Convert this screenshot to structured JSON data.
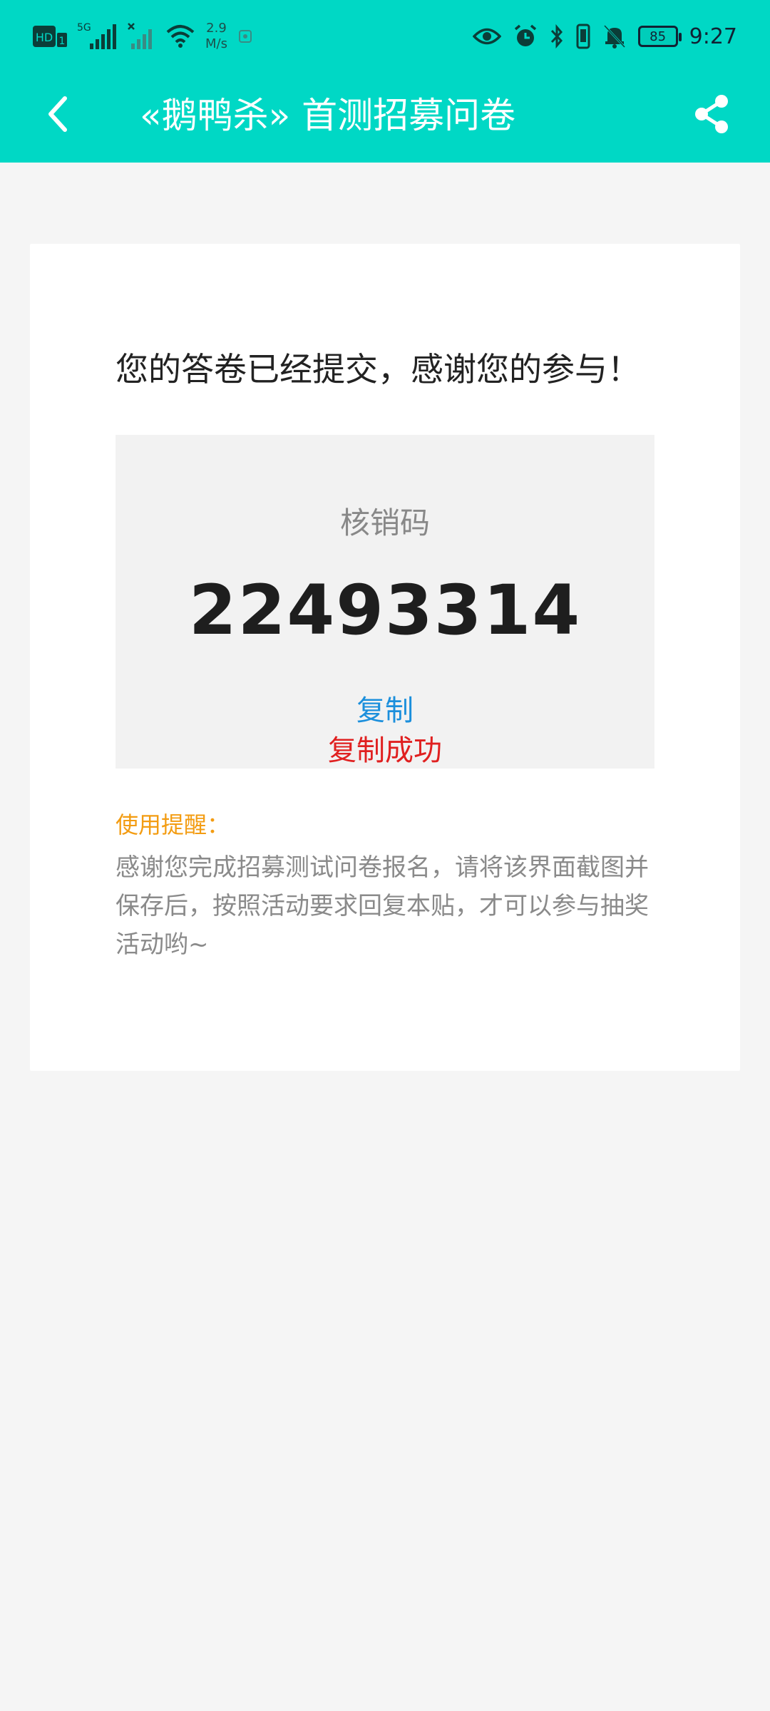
{
  "status_bar": {
    "network_badge": "HD",
    "sim_indicator": "1",
    "network_type": "5G",
    "speed_value": "2.9",
    "speed_unit": "M/s",
    "battery": "85",
    "time": "9:27",
    "icons": [
      "hd-icon",
      "signal-icon",
      "wifi-icon",
      "eye-icon",
      "alarm-icon",
      "bluetooth-icon",
      "vibrate-icon",
      "mute-icon",
      "battery-icon"
    ]
  },
  "app_bar": {
    "title": "«鹅鸭杀» 首测招募问卷",
    "back_icon": "chevron-left-icon",
    "share_icon": "share-icon"
  },
  "result": {
    "headline": "您的答卷已经提交，感谢您的参与！",
    "code_label": "核销码",
    "code_value": "22493314",
    "copy_label": "复制",
    "copy_status": "复制成功"
  },
  "tip": {
    "title": "使用提醒：",
    "body": "感谢您完成招募测试问卷报名，请将该界面截图并保存后，按照活动要求回复本贴，才可以参与抽奖活动哟~"
  },
  "colors": {
    "primary": "#00d8c5",
    "link": "#1b8fdc",
    "success": "#e02020",
    "tip_title": "#f39c12"
  }
}
